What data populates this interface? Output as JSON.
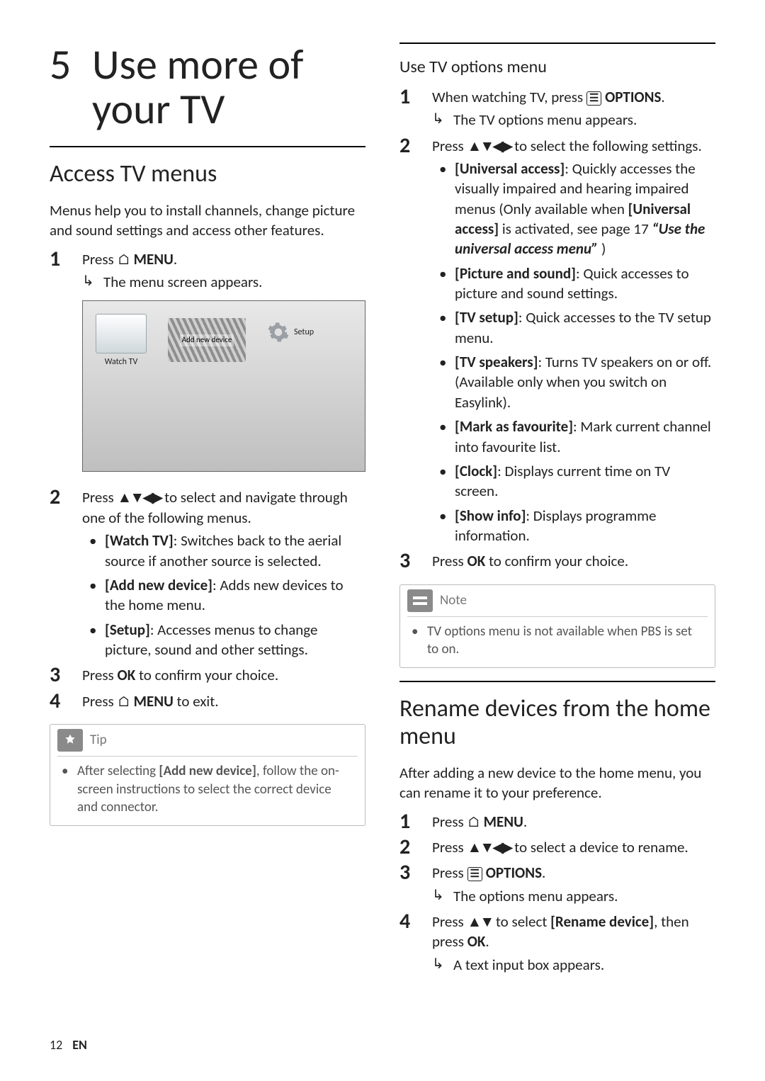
{
  "page": {
    "number": "12",
    "lang": "EN"
  },
  "chapter": {
    "number": "5",
    "title_line1": "Use more of",
    "title_line2": "your TV"
  },
  "icons": {
    "home": "⌂",
    "options_box": "☰",
    "arrows4": "▲▼◀▶",
    "arrows2": "▲▼"
  },
  "tv_image": {
    "watch": "Watch TV",
    "add": "Add new device",
    "setup": "Setup"
  },
  "access": {
    "heading": "Access TV menus",
    "intro": "Menus help you to install channels, change picture and sound settings and access other features.",
    "step1_prefix": "Press ",
    "step1_button": " MENU",
    "step1_suffix": ".",
    "step1_result": "The menu screen appears.",
    "step2_a": "Press ",
    "step2_b": " to select and navigate through one of the following menus.",
    "step2_items": [
      {
        "label": "[Watch TV]",
        "desc": ": Switches back to the aerial source if another source is selected."
      },
      {
        "label": "[Add new device]",
        "desc": ": Adds new devices to the home menu."
      },
      {
        "label": "[Setup]",
        "desc": ": Accesses menus to change picture, sound and other settings."
      }
    ],
    "step3_a": "Press ",
    "step3_ok": "OK",
    "step3_b": " to confirm your choice.",
    "step4_a": "Press ",
    "step4_button": " MENU",
    "step4_b": " to exit."
  },
  "tip": {
    "label": "Tip",
    "text_a": "After selecting ",
    "text_label": "[Add new device]",
    "text_b": ", follow the on-screen instructions to select the correct device and connector."
  },
  "optionsMenu": {
    "heading": "Use TV options menu",
    "step1_a": "When watching TV, press ",
    "step1_button": " OPTIONS",
    "step1_b": ".",
    "step1_result": "The TV options menu appears.",
    "step2_a": "Press ",
    "step2_b": " to select the following settings.",
    "items": [
      {
        "label": "[Universal access]",
        "desc_a": ": Quickly accesses the visually impaired and hearing impaired menus (Only available when ",
        "desc_label": "[Universal access]",
        "desc_b": " is activated, see page 17 ",
        "desc_quote": "“Use the universal access menu”",
        "desc_c": " )"
      },
      {
        "label": "[Picture and sound]",
        "desc": ": Quick accesses to picture and sound settings."
      },
      {
        "label": "[TV setup]",
        "desc": ": Quick accesses to the TV setup menu."
      },
      {
        "label": "[TV speakers]",
        "desc": ": Turns TV speakers on or off. (Available only when you switch on Easylink)."
      },
      {
        "label": "[Mark as favourite]",
        "desc": ": Mark current channel into favourite list."
      },
      {
        "label": "[Clock]",
        "desc": ": Displays current time on TV screen."
      },
      {
        "label": "[Show info]",
        "desc": ": Displays programme information."
      }
    ],
    "step3_a": "Press ",
    "step3_ok": "OK",
    "step3_b": " to confirm your choice."
  },
  "note": {
    "label": "Note",
    "text": "TV options menu is not available when PBS is set to on."
  },
  "rename": {
    "heading": "Rename devices from the home menu",
    "intro": "After adding a new device to the home menu, you can rename it to your preference.",
    "step1_a": "Press ",
    "step1_button": " MENU",
    "step1_b": ".",
    "step2_a": "Press ",
    "step2_b": " to select a device to rename.",
    "step3_a": "Press ",
    "step3_button": " OPTIONS",
    "step3_b": ".",
    "step3_result": "The options menu appears.",
    "step4_a": "Press ",
    "step4_b": " to select ",
    "step4_label": "[Rename device]",
    "step4_c": ", then press ",
    "step4_ok": "OK",
    "step4_d": ".",
    "step4_result": "A text input box appears."
  }
}
